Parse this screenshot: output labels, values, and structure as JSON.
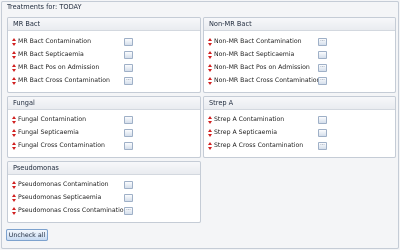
{
  "title": "Treatments for: TODAY",
  "groups": {
    "mr_bact": {
      "title": "MR Bact",
      "items": [
        {
          "label": "MR Bact Contamination",
          "button": ""
        },
        {
          "label": "MR Bact Septicaemia",
          "button": ""
        },
        {
          "label": "MR Bact Pos on Admission",
          "button": ""
        },
        {
          "label": "MR Bact Cross Contamination",
          "button": "..."
        }
      ]
    },
    "non_mr_bact": {
      "title": "Non-MR Bact",
      "items": [
        {
          "label": "Non-MR Bact Contamination",
          "button": "..."
        },
        {
          "label": "Non-MR Bact Septicaemia",
          "button": ""
        },
        {
          "label": "Non-MR Bact Pos on Admission",
          "button": "..."
        },
        {
          "label": "Non-MR Bact Cross Contamination",
          "button": "..."
        }
      ]
    },
    "fungal": {
      "title": "Fungal",
      "items": [
        {
          "label": "Fungal Contamination",
          "button": ""
        },
        {
          "label": "Fungal Septicaemia",
          "button": ""
        },
        {
          "label": "Fungal Cross Contamination",
          "button": ""
        }
      ]
    },
    "strep_a": {
      "title": "Strep A",
      "items": [
        {
          "label": "Strep A Contamination",
          "button": ""
        },
        {
          "label": "Strep A Septicaemia",
          "button": ""
        },
        {
          "label": "Strep A Cross Contamination",
          "button": "..."
        }
      ]
    },
    "pseudomonas": {
      "title": "Pseudomonas",
      "items": [
        {
          "label": "Pseudomonas Contamination",
          "button": ""
        },
        {
          "label": "Pseudomonas Septicaemia",
          "button": ""
        },
        {
          "label": "Pseudomonas Cross Contamination",
          "button": "..."
        }
      ]
    }
  },
  "uncheck_all_label": "Uncheck all",
  "colors": {
    "arrow": "#d01e1e",
    "panel_border": "#c5ccd6",
    "button_border": "#7da2ce"
  }
}
